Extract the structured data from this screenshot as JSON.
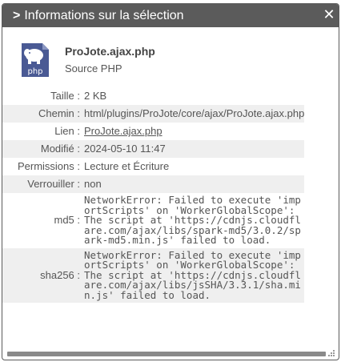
{
  "dialog": {
    "title": "Informations sur la sélection",
    "chevron": ">",
    "close_glyph": "✕"
  },
  "file": {
    "name": "ProJote.ajax.php",
    "type": "Source PHP",
    "icon": "php-file-icon",
    "icon_label": "php",
    "icon_color": "#4a5a94"
  },
  "properties": [
    {
      "key": "Taille :",
      "value": "2 KB"
    },
    {
      "key": "Chemin :",
      "value": "html/plugins/ProJote/core/ajax/ProJote.ajax.php"
    },
    {
      "key": "Lien :",
      "value": "ProJote.ajax.php"
    },
    {
      "key": "Modifié :",
      "value": "2024-05-10 11:47"
    },
    {
      "key": "Permissions :",
      "value": "Lecture et Écriture"
    },
    {
      "key": "Verrouiller :",
      "value": "non"
    },
    {
      "key": "md5 :",
      "value": "NetworkError: Failed to execute 'importScripts' on 'WorkerGlobalScope': The script at 'https://cdnjs.cloudflare.com/ajax/libs/spark-md5/3.0.2/spark-md5.min.js' failed to load."
    },
    {
      "key": "sha256 :",
      "value": "NetworkError: Failed to execute 'importScripts' on 'WorkerGlobalScope': The script at 'https://cdnjs.cloudflare.com/ajax/libs/jsSHA/3.3.1/sha.min.js' failed to load."
    }
  ]
}
